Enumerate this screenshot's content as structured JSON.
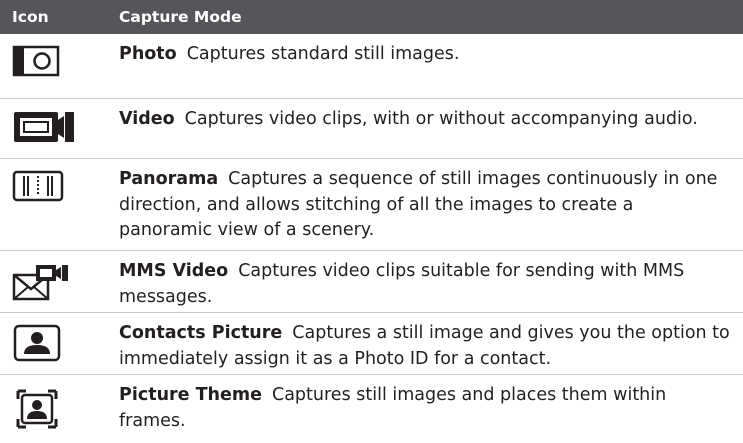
{
  "table": {
    "header": {
      "icon": "Icon",
      "mode": "Capture Mode"
    },
    "rows": [
      {
        "icon": "photo-icon",
        "title": "Photo",
        "desc": "Captures standard still images."
      },
      {
        "icon": "video-icon",
        "title": "Video",
        "desc": "Captures video clips, with or without accompanying audio."
      },
      {
        "icon": "panorama-icon",
        "title": "Panorama",
        "desc": "Captures a sequence of still images continuously in one direction, and allows stitching of all the images to create a panoramic view of a scenery."
      },
      {
        "icon": "mms-video-icon",
        "title": "MMS Video",
        "desc": "Captures video clips suitable for sending with MMS messages."
      },
      {
        "icon": "contacts-picture-icon",
        "title": "Contacts Picture",
        "desc": "Captures a still image and gives you the option to immediately assign it as a Photo ID for a contact."
      },
      {
        "icon": "picture-theme-icon",
        "title": "Picture Theme",
        "desc": "Captures still images and places them within frames."
      }
    ]
  }
}
